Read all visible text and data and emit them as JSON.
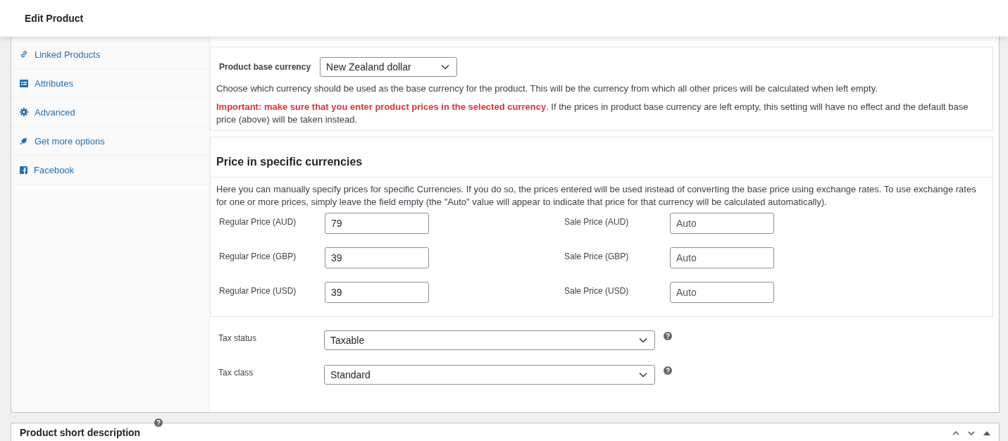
{
  "header": {
    "title": "Edit Product"
  },
  "sidebar": {
    "items": [
      {
        "label": "Linked Products",
        "kind": "link"
      },
      {
        "label": "Attributes",
        "kind": "list"
      },
      {
        "label": "Advanced",
        "kind": "gear"
      },
      {
        "label": "Get more options",
        "kind": "plug"
      },
      {
        "label": "Facebook",
        "kind": "facebook"
      }
    ]
  },
  "base_currency": {
    "label": "Product base currency",
    "value": "New Zealand dollar",
    "description": "Choose which currency should be used as the base currency for the product. This will be the currency from which all other prices will be calculated when left empty.",
    "important": "**Important: make sure that you enter product prices in the selected currency**. If the prices in product base currency are left empty, this setting will have no effect and the default base price (above) will be taken instead."
  },
  "specific_prices": {
    "title": "Price in specific currencies",
    "description": "Here you can manually specify prices for specific Currencies. If you do so, the prices entered will be used instead of converting the base price using exchange rates. To use exchange rates for one or more prices, simply leave the field empty (the \"Auto\" value will appear to indicate that price for that currency will be calculated automatically).",
    "rows": [
      {
        "regular_label": "Regular Price (AUD)",
        "regular_value": "79",
        "sale_label": "Sale Price (AUD)",
        "sale_placeholder": "Auto"
      },
      {
        "regular_label": "Regular Price (GBP)",
        "regular_value": "39",
        "sale_label": "Sale Price (GBP)",
        "sale_placeholder": "Auto"
      },
      {
        "regular_label": "Regular Price (USD)",
        "regular_value": "39",
        "sale_label": "Sale Price (USD)",
        "sale_placeholder": "Auto"
      }
    ]
  },
  "tax": [
    {
      "label": "Tax status",
      "value": "Taxable"
    },
    {
      "label": "Tax class",
      "value": "Standard"
    }
  ],
  "short_description": {
    "title": "Product short description"
  }
}
